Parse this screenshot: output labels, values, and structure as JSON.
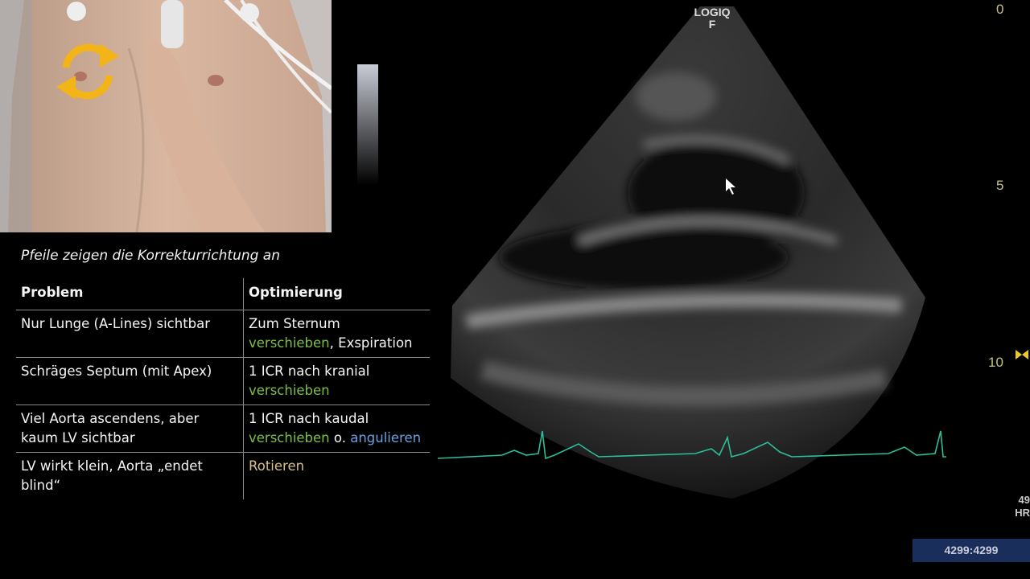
{
  "logo": {
    "line1": "LOGIQ",
    "line2": "F"
  },
  "caption": "Pfeile zeigen die Korrekturrichtung an",
  "table": {
    "header": {
      "problem": "Problem",
      "optimierung": "Optimierung"
    },
    "rows": [
      {
        "problem": "Nur Lunge (A-Lines) sichtbar",
        "opt_a": "Zum Sternum",
        "opt_b": "verschieben",
        "opt_c": ", Exspiration",
        "opt_d": "",
        "opt_e": ""
      },
      {
        "problem": "Schräges Septum (mit Apex)",
        "opt_a": "1 ICR nach kranial",
        "opt_b": "verschieben",
        "opt_c": "",
        "opt_d": "",
        "opt_e": ""
      },
      {
        "problem": "Viel Aorta ascendens, aber kaum LV sichtbar",
        "opt_a": "1 ICR nach kaudal",
        "opt_b": "verschieben",
        "opt_c": " o. ",
        "opt_d": "angulieren",
        "opt_e": ""
      },
      {
        "problem": "LV wirkt klein, Aorta „endet blind“",
        "opt_a": "",
        "opt_b": "",
        "opt_c": "",
        "opt_d": "",
        "opt_e": "Rotieren"
      }
    ]
  },
  "depth_scale": {
    "d0": "0",
    "d5": "5",
    "d10": "10"
  },
  "hr": {
    "value": "49",
    "label": "HR"
  },
  "frame_counter": "4299:4299",
  "colors": {
    "green": "#7bbf4b",
    "blue": "#6aa0e0",
    "tan": "#d8c089",
    "ecg": "#2bbf9a",
    "rotate_icon": "#f2b416"
  }
}
